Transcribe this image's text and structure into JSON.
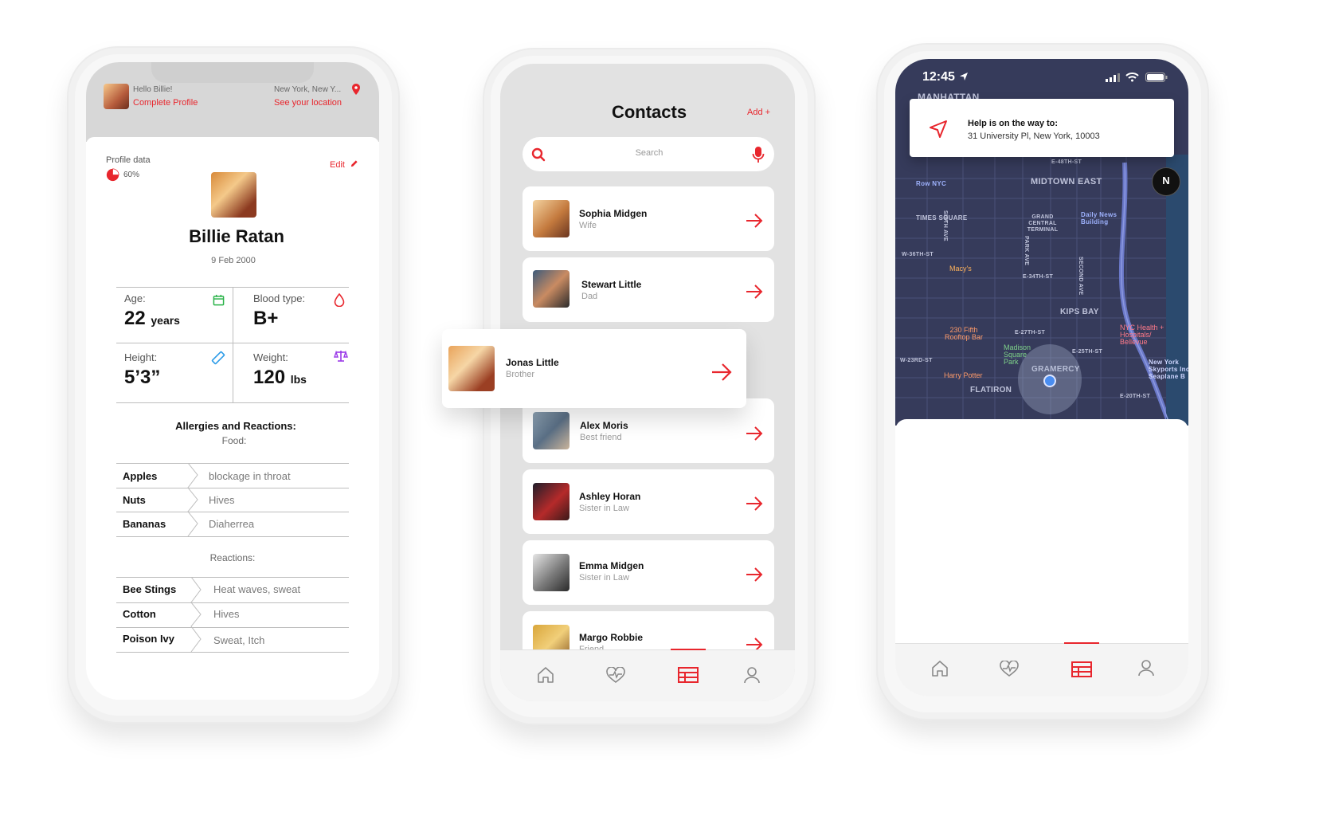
{
  "profile_screen": {
    "greeting": "Hello Billie!",
    "complete_profile": "Complete Profile",
    "location": "New York, New Y...",
    "see_location": "See your location",
    "profile_data_label": "Profile data",
    "progress_text": "60%",
    "progress_value": 0.6,
    "edit_label": "Edit",
    "name": "Billie Ratan",
    "dob": "9 Feb 2000",
    "age_label": "Age:",
    "age_value": "22",
    "age_unit": "years",
    "blood_label": "Blood type:",
    "blood_value": "B+",
    "height_label": "Height:",
    "height_value": "5’3”",
    "weight_label": "Weight:",
    "weight_value": "120",
    "weight_unit": "lbs",
    "allergies_title": "Allergies and Reactions:",
    "food_label": "Food:",
    "food": [
      {
        "item": "Apples",
        "reaction": "blockage in throat"
      },
      {
        "item": "Nuts",
        "reaction": "Hives"
      },
      {
        "item": "Bananas",
        "reaction": "Diaherrea"
      }
    ],
    "reactions_label": "Reactions:",
    "reactions": [
      {
        "item": "Bee Stings",
        "reaction": "Heat waves, sweat"
      },
      {
        "item": "Cotton",
        "reaction": "Hives"
      },
      {
        "item": "Poison Ivy",
        "reaction": "Sweat, Itch"
      }
    ]
  },
  "contacts_screen": {
    "title": "Contacts",
    "add_label": "Add +",
    "search_placeholder": "Search",
    "contacts": [
      {
        "name": "Sophia Midgen",
        "relation": "Wife"
      },
      {
        "name": "Stewart Little",
        "relation": "Dad"
      },
      {
        "name": "Jonas Little",
        "relation": "Brother"
      },
      {
        "name": "Alex Moris",
        "relation": "Best friend"
      },
      {
        "name": "Ashley Horan",
        "relation": "Sister in Law"
      },
      {
        "name": "Emma Midgen",
        "relation": "Sister in Law"
      },
      {
        "name": "Margo Robbie",
        "relation": "Friend"
      }
    ]
  },
  "map_screen": {
    "time": "12:45",
    "help_title": "Help is on the way to:",
    "help_address": "31 University Pl, New York, 10003",
    "compass": "N",
    "labels": {
      "manhattan": "MANHATTAN",
      "midtown_east": "MIDTOWN EAST",
      "kips_bay": "KIPS BAY",
      "gramercy": "GRAMERCY",
      "flatiron": "FLATIRON",
      "times_square": "TIMES SQUARE",
      "grand_central": "GRAND CENTRAL TERMINAL",
      "row_nyc": "Row NYC",
      "macys": "Macy's",
      "daily_news": "Daily News Building",
      "rooftop": "230 Fifth Rooftop Bar",
      "madison": "Madison Square Park",
      "harry_potter": "Harry Potter",
      "nyc_health": "NYC Health + Hospitals/ Bellevue",
      "seaplane": "New York Skyports Inc Seaplane B",
      "sixth_ave": "SIXTH AVE",
      "park_ave": "PARK AVE",
      "second_ave": "SECOND AVE",
      "w36": "W-36TH-ST",
      "e34": "E-34TH-ST",
      "e48": "E-48TH-ST",
      "w23": "W-23RD-ST",
      "e27": "E-27TH-ST",
      "e25": "E-25TH-ST",
      "e20": "E-20TH-ST"
    }
  },
  "colors": {
    "accent": "#e8262d",
    "map_bg": "#353a5a",
    "phone_body": "#f4f4f4"
  },
  "nav_icons": [
    "home-icon",
    "heart-pulse-icon",
    "table-icon",
    "user-icon"
  ]
}
